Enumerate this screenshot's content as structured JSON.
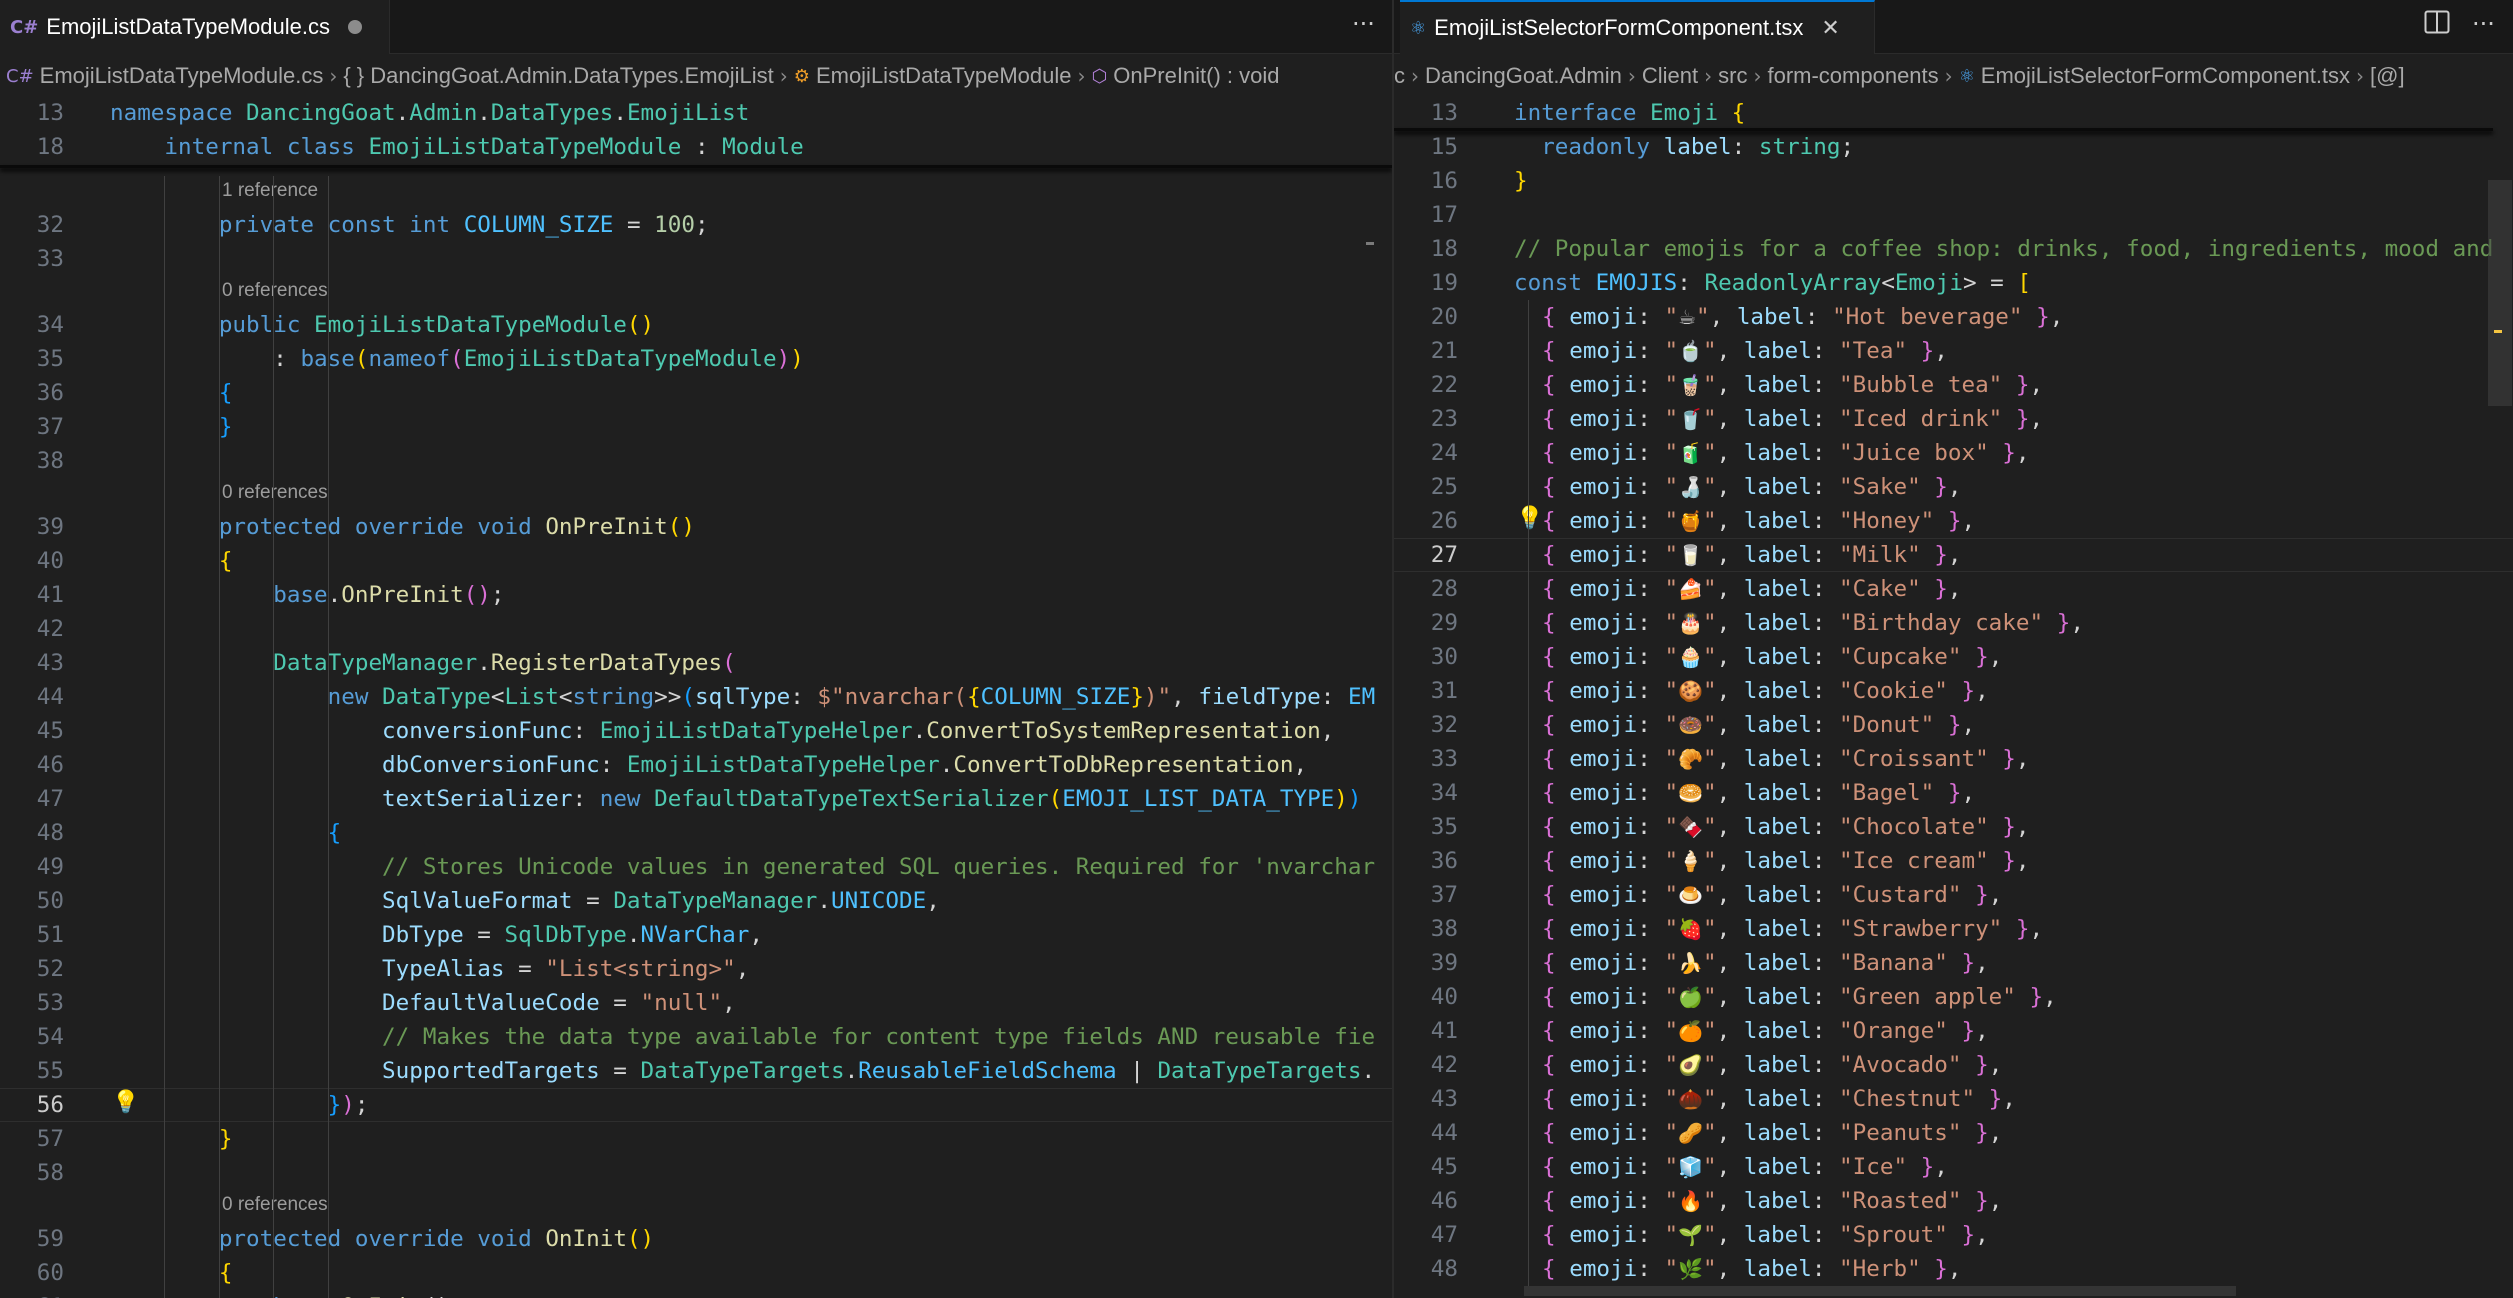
{
  "left": {
    "tab": {
      "title": "EmojiListDataTypeModule.cs",
      "icon": "csharp-file-icon"
    },
    "actions": {
      "more": "···"
    },
    "breadcrumb": [
      "EmojiListDataTypeModule.cs",
      "{ } DancingGoat.Admin.DataTypes.EmojiList",
      "EmojiListDataTypeModule",
      "OnPreInit() : void"
    ],
    "sticky": [
      {
        "n": "13",
        "t": [
          [
            "namespace ",
            "kw"
          ],
          [
            "DancingGoat",
            "ty"
          ],
          [
            ".",
            "pl"
          ],
          [
            "Admin",
            "ty"
          ],
          [
            ".",
            "pl"
          ],
          [
            "DataTypes",
            "ty"
          ],
          [
            ".",
            "pl"
          ],
          [
            "EmojiList",
            "ty"
          ]
        ]
      },
      {
        "n": "18",
        "t": [
          [
            "    internal ",
            "kw"
          ],
          [
            "class ",
            "kw"
          ],
          [
            "EmojiListDataTypeModule",
            "ty"
          ],
          [
            " : ",
            "pl"
          ],
          [
            "Module",
            "ty"
          ]
        ]
      }
    ],
    "lines": [
      {
        "lens": "1 reference"
      },
      {
        "n": "32",
        "t": [
          [
            "        private ",
            "kw"
          ],
          [
            "const ",
            "kw"
          ],
          [
            "int ",
            "kw"
          ],
          [
            "COLUMN_SIZE",
            "co"
          ],
          [
            " = ",
            "pl"
          ],
          [
            "100",
            "nu"
          ],
          [
            ";",
            "pl"
          ]
        ]
      },
      {
        "n": "33",
        "t": []
      },
      {
        "lens": "0 references"
      },
      {
        "n": "34",
        "t": [
          [
            "        public ",
            "kw"
          ],
          [
            "EmojiListDataTypeModule",
            "ty"
          ],
          [
            "()",
            "b1"
          ]
        ]
      },
      {
        "n": "35",
        "t": [
          [
            "            : ",
            "pl"
          ],
          [
            "base",
            "kw"
          ],
          [
            "(",
            "b1"
          ],
          [
            "nameof",
            "kw"
          ],
          [
            "(",
            "b2"
          ],
          [
            "EmojiListDataTypeModule",
            "ty"
          ],
          [
            ")",
            "b2"
          ],
          [
            ")",
            "b1"
          ]
        ]
      },
      {
        "n": "36",
        "t": [
          [
            "        {",
            "b3"
          ]
        ]
      },
      {
        "n": "37",
        "t": [
          [
            "        }",
            "b3"
          ]
        ]
      },
      {
        "n": "38",
        "t": []
      },
      {
        "lens": "0 references"
      },
      {
        "n": "39",
        "t": [
          [
            "        protected ",
            "kw"
          ],
          [
            "override ",
            "kw"
          ],
          [
            "void ",
            "kw"
          ],
          [
            "OnPreInit",
            "fn"
          ],
          [
            "()",
            "b1"
          ]
        ]
      },
      {
        "n": "40",
        "t": [
          [
            "        {",
            "b1"
          ]
        ]
      },
      {
        "n": "41",
        "t": [
          [
            "            base",
            "kw"
          ],
          [
            ".",
            "pl"
          ],
          [
            "OnPreInit",
            "fn"
          ],
          [
            "()",
            "b2"
          ],
          [
            ";",
            "pl"
          ]
        ]
      },
      {
        "n": "42",
        "t": []
      },
      {
        "n": "43",
        "t": [
          [
            "            DataTypeManager",
            "ty"
          ],
          [
            ".",
            "pl"
          ],
          [
            "RegisterDataTypes",
            "fn"
          ],
          [
            "(",
            "b2"
          ]
        ]
      },
      {
        "n": "44",
        "t": [
          [
            "                new ",
            "kw"
          ],
          [
            "DataType",
            "ty"
          ],
          [
            "<",
            "pl"
          ],
          [
            "List",
            "ty"
          ],
          [
            "<",
            "pl"
          ],
          [
            "string",
            "kw"
          ],
          [
            ">>",
            "pl"
          ],
          [
            "(",
            "b3"
          ],
          [
            "sqlType",
            "pr"
          ],
          [
            ": ",
            "pl"
          ],
          [
            "$\"nvarchar(",
            "st"
          ],
          [
            "{",
            "b1"
          ],
          [
            "COLUMN_SIZE",
            "co"
          ],
          [
            "}",
            "b1"
          ],
          [
            ")\"",
            "st"
          ],
          [
            ", ",
            "pl"
          ],
          [
            "fieldType",
            "pr"
          ],
          [
            ": ",
            "pl"
          ],
          [
            "EM",
            "co"
          ]
        ]
      },
      {
        "n": "45",
        "t": [
          [
            "                    conversionFunc",
            "pr"
          ],
          [
            ": ",
            "pl"
          ],
          [
            "EmojiListDataTypeHelper",
            "ty"
          ],
          [
            ".",
            "pl"
          ],
          [
            "ConvertToSystemRepresentation",
            "fn"
          ],
          [
            ",",
            "pl"
          ]
        ]
      },
      {
        "n": "46",
        "t": [
          [
            "                    dbConversionFunc",
            "pr"
          ],
          [
            ": ",
            "pl"
          ],
          [
            "EmojiListDataTypeHelper",
            "ty"
          ],
          [
            ".",
            "pl"
          ],
          [
            "ConvertToDbRepresentation",
            "fn"
          ],
          [
            ",",
            "pl"
          ]
        ]
      },
      {
        "n": "47",
        "t": [
          [
            "                    textSerializer",
            "pr"
          ],
          [
            ": ",
            "pl"
          ],
          [
            "new ",
            "kw"
          ],
          [
            "DefaultDataTypeTextSerializer",
            "ty"
          ],
          [
            "(",
            "b1"
          ],
          [
            "EMOJI_LIST_DATA_TYPE",
            "co"
          ],
          [
            ")",
            "b1"
          ],
          [
            ")",
            "b3"
          ]
        ]
      },
      {
        "n": "48",
        "t": [
          [
            "                {",
            "b3"
          ]
        ]
      },
      {
        "n": "49",
        "t": [
          [
            "                    // Stores Unicode values in generated SQL queries. Required for 'nvarchar",
            "cm"
          ]
        ]
      },
      {
        "n": "50",
        "t": [
          [
            "                    SqlValueFormat",
            "pr"
          ],
          [
            " = ",
            "pl"
          ],
          [
            "DataTypeManager",
            "ty"
          ],
          [
            ".",
            "pl"
          ],
          [
            "UNICODE",
            "co"
          ],
          [
            ",",
            "pl"
          ]
        ]
      },
      {
        "n": "51",
        "t": [
          [
            "                    DbType",
            "pr"
          ],
          [
            " = ",
            "pl"
          ],
          [
            "SqlDbType",
            "ty"
          ],
          [
            ".",
            "pl"
          ],
          [
            "NVarChar",
            "co"
          ],
          [
            ",",
            "pl"
          ]
        ]
      },
      {
        "n": "52",
        "t": [
          [
            "                    TypeAlias",
            "pr"
          ],
          [
            " = ",
            "pl"
          ],
          [
            "\"List<string>\"",
            "st"
          ],
          [
            ",",
            "pl"
          ]
        ]
      },
      {
        "n": "53",
        "t": [
          [
            "                    DefaultValueCode",
            "pr"
          ],
          [
            " = ",
            "pl"
          ],
          [
            "\"null\"",
            "st"
          ],
          [
            ",",
            "pl"
          ]
        ]
      },
      {
        "n": "54",
        "t": [
          [
            "                    // Makes the data type available for content type fields AND reusable fie",
            "cm"
          ]
        ]
      },
      {
        "n": "55",
        "t": [
          [
            "                    SupportedTargets",
            "pr"
          ],
          [
            " = ",
            "pl"
          ],
          [
            "DataTypeTargets",
            "ty"
          ],
          [
            ".",
            "pl"
          ],
          [
            "ReusableFieldSchema",
            "co"
          ],
          [
            " | ",
            "pl"
          ],
          [
            "DataTypeTargets",
            "ty"
          ],
          [
            ".",
            "pl"
          ]
        ]
      },
      {
        "n": "56",
        "t": [
          [
            "                }",
            "b3"
          ],
          [
            ")",
            "b2"
          ],
          [
            ";",
            "pl"
          ]
        ],
        "current": true,
        "bulb": true
      },
      {
        "n": "57",
        "t": [
          [
            "        }",
            "b1"
          ]
        ]
      },
      {
        "n": "58",
        "t": []
      },
      {
        "lens": "0 references"
      },
      {
        "n": "59",
        "t": [
          [
            "        protected ",
            "kw"
          ],
          [
            "override ",
            "kw"
          ],
          [
            "void ",
            "kw"
          ],
          [
            "OnInit",
            "fn"
          ],
          [
            "()",
            "b1"
          ]
        ]
      },
      {
        "n": "60",
        "t": [
          [
            "        {",
            "b1"
          ]
        ]
      },
      {
        "n": "61",
        "t": [
          [
            "            base",
            "kw"
          ],
          [
            ".",
            "pl"
          ],
          [
            "OnInit",
            "fn"
          ],
          [
            "();",
            "pl"
          ]
        ]
      }
    ]
  },
  "right": {
    "tab": {
      "title": "EmojiListSelectorFormComponent.tsx",
      "icon": "react-file-icon"
    },
    "actions": {
      "split": "split-editor-icon"
    },
    "breadcrumb": [
      "c",
      "DancingGoat.Admin",
      "Client",
      "src",
      "form-components",
      "EmojiListSelectorFormComponent.tsx",
      "[@]"
    ],
    "sticky": [
      {
        "n": "13",
        "t": [
          [
            "interface ",
            "kw"
          ],
          [
            "Emoji ",
            "ty"
          ],
          [
            "{",
            "b1"
          ]
        ]
      }
    ],
    "lines": [
      {
        "n": "15",
        "t": [
          [
            "  readonly ",
            "kw"
          ],
          [
            "label",
            "pr"
          ],
          [
            ": ",
            "pl"
          ],
          [
            "string",
            "ty"
          ],
          [
            ";",
            "pl"
          ]
        ]
      },
      {
        "n": "16",
        "t": [
          [
            "}",
            "b1"
          ]
        ]
      },
      {
        "n": "17",
        "t": []
      },
      {
        "n": "18",
        "t": [
          [
            "// Popular emojis for a coffee shop: drinks, food, ingredients, mood and",
            "cm"
          ]
        ]
      },
      {
        "n": "19",
        "t": [
          [
            "const ",
            "kw"
          ],
          [
            "EMOJIS",
            "co"
          ],
          [
            ": ",
            "pl"
          ],
          [
            "ReadonlyArray",
            "ty"
          ],
          [
            "<",
            "pl"
          ],
          [
            "Emoji",
            "ty"
          ],
          [
            ">",
            "pl"
          ],
          [
            " = ",
            "pl"
          ],
          [
            "[",
            "b1"
          ]
        ]
      }
    ],
    "emojis": [
      {
        "n": "20",
        "emoji": "☕",
        "label": "Hot beverage"
      },
      {
        "n": "21",
        "emoji": "🍵",
        "label": "Tea"
      },
      {
        "n": "22",
        "emoji": "🧋",
        "label": "Bubble tea"
      },
      {
        "n": "23",
        "emoji": "🥤",
        "label": "Iced drink"
      },
      {
        "n": "24",
        "emoji": "🧃",
        "label": "Juice box"
      },
      {
        "n": "25",
        "emoji": "🍶",
        "label": "Sake"
      },
      {
        "n": "26",
        "emoji": "🍯",
        "label": "Honey",
        "bulb": true
      },
      {
        "n": "27",
        "emoji": "🥛",
        "label": "Milk",
        "current": true
      },
      {
        "n": "28",
        "emoji": "🍰",
        "label": "Cake"
      },
      {
        "n": "29",
        "emoji": "🎂",
        "label": "Birthday cake"
      },
      {
        "n": "30",
        "emoji": "🧁",
        "label": "Cupcake"
      },
      {
        "n": "31",
        "emoji": "🍪",
        "label": "Cookie"
      },
      {
        "n": "32",
        "emoji": "🍩",
        "label": "Donut"
      },
      {
        "n": "33",
        "emoji": "🥐",
        "label": "Croissant"
      },
      {
        "n": "34",
        "emoji": "🥯",
        "label": "Bagel"
      },
      {
        "n": "35",
        "emoji": "🍫",
        "label": "Chocolate"
      },
      {
        "n": "36",
        "emoji": "🍦",
        "label": "Ice cream"
      },
      {
        "n": "37",
        "emoji": "🍮",
        "label": "Custard"
      },
      {
        "n": "38",
        "emoji": "🍓",
        "label": "Strawberry"
      },
      {
        "n": "39",
        "emoji": "🍌",
        "label": "Banana"
      },
      {
        "n": "40",
        "emoji": "🍏",
        "label": "Green apple"
      },
      {
        "n": "41",
        "emoji": "🍊",
        "label": "Orange"
      },
      {
        "n": "42",
        "emoji": "🥑",
        "label": "Avocado"
      },
      {
        "n": "43",
        "emoji": "🌰",
        "label": "Chestnut"
      },
      {
        "n": "44",
        "emoji": "🥜",
        "label": "Peanuts"
      },
      {
        "n": "45",
        "emoji": "🧊",
        "label": "Ice"
      },
      {
        "n": "46",
        "emoji": "🔥",
        "label": "Roasted"
      },
      {
        "n": "47",
        "emoji": "🌱",
        "label": "Sprout"
      },
      {
        "n": "48",
        "emoji": "🌿",
        "label": "Herb"
      }
    ]
  },
  "colors": {
    "background": "#1f1f1f",
    "tabbar": "#181818",
    "accent": "#0078d4",
    "lightbulb": "#f5c542"
  }
}
